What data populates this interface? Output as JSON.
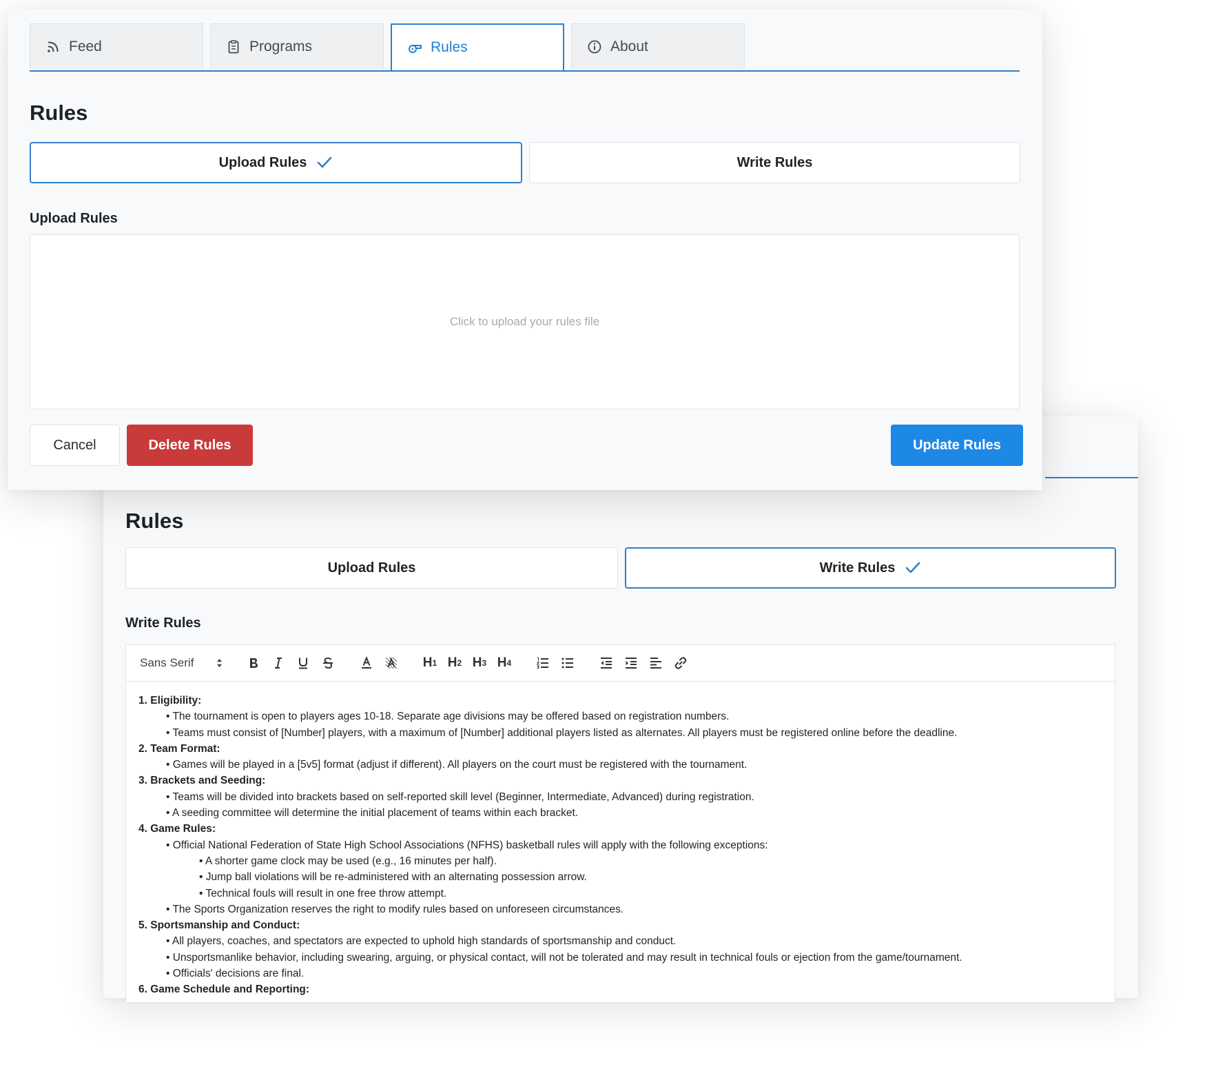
{
  "upload_view": {
    "tabs": [
      {
        "label": "Feed",
        "icon": "rss-icon"
      },
      {
        "label": "Programs",
        "icon": "clipboard-icon"
      },
      {
        "label": "Rules",
        "icon": "whistle-icon",
        "active": true
      },
      {
        "label": "About",
        "icon": "info-icon"
      }
    ],
    "title": "Rules",
    "toggle_upload": "Upload Rules",
    "toggle_write": "Write Rules",
    "selected_mode": "Upload Rules",
    "field_label": "Upload Rules",
    "dropzone_text": "Click to upload your rules file",
    "cancel_label": "Cancel",
    "delete_label": "Delete Rules",
    "update_label": "Update Rules"
  },
  "write_view": {
    "title": "Rules",
    "toggle_upload": "Upload Rules",
    "toggle_write": "Write Rules",
    "selected_mode": "Write Rules",
    "field_label": "Write Rules",
    "editor": {
      "font_select": "Sans Serif",
      "toolbar_icons": [
        "bold-icon",
        "italic-icon",
        "underline-icon",
        "strikethrough-icon",
        "text-color-icon",
        "highlight-icon",
        "h1-icon",
        "h2-icon",
        "h3-icon",
        "h4-icon",
        "ordered-list-icon",
        "bullet-list-icon",
        "outdent-icon",
        "indent-icon",
        "align-icon",
        "link-icon"
      ],
      "lines": [
        {
          "level": 0,
          "text": "1. Eligibility:"
        },
        {
          "level": 1,
          "text": "• The tournament is open to players ages 10-18. Separate age divisions may be offered based on registration numbers."
        },
        {
          "level": 1,
          "text": "• Teams must consist of [Number] players, with a maximum of [Number] additional players listed as alternates. All players must be registered online before the deadline."
        },
        {
          "level": 0,
          "text": "2. Team Format:"
        },
        {
          "level": 1,
          "text": "• Games will be played in a [5v5] format (adjust if different). All players on the court must be registered with the tournament."
        },
        {
          "level": 0,
          "text": "3. Brackets and Seeding:"
        },
        {
          "level": 1,
          "text": "• Teams will be divided into brackets based on self-reported skill level (Beginner, Intermediate, Advanced) during registration."
        },
        {
          "level": 1,
          "text": "• A seeding committee will determine the initial placement of teams within each bracket."
        },
        {
          "level": 0,
          "text": "4. Game Rules:"
        },
        {
          "level": 1,
          "text": "• Official National Federation of State High School Associations (NFHS) basketball rules will apply with the following exceptions:"
        },
        {
          "level": 2,
          "text": "• A shorter game clock may be used (e.g., 16 minutes per half)."
        },
        {
          "level": 2,
          "text": "• Jump ball violations will be re-administered with an alternating possession arrow."
        },
        {
          "level": 2,
          "text": "• Technical fouls will result in one free throw attempt."
        },
        {
          "level": 1,
          "text": "• The Sports Organization reserves the right to modify rules based on unforeseen circumstances."
        },
        {
          "level": 0,
          "text": "5. Sportsmanship and Conduct:"
        },
        {
          "level": 1,
          "text": "• All players, coaches, and spectators are expected to uphold high standards of sportsmanship and conduct."
        },
        {
          "level": 1,
          "text": "• Unsportsmanlike behavior, including swearing, arguing, or physical contact, will not be tolerated and may result in technical fouls or ejection from the game/tournament."
        },
        {
          "level": 1,
          "text": "• Officials' decisions are final."
        },
        {
          "level": 0,
          "text": "6. Game Schedule and Reporting:"
        }
      ]
    }
  },
  "colors": {
    "accent": "#2f80c8",
    "primary_button": "#1e88e5",
    "danger_button": "#c93a3a",
    "panel_bg": "#f8f9fa"
  }
}
